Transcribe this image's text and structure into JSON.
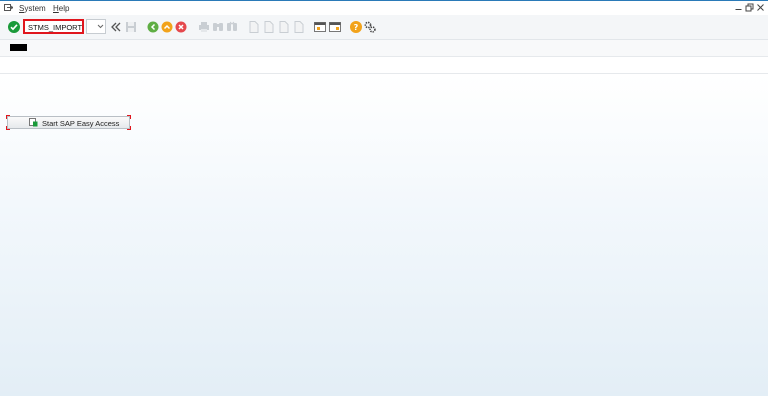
{
  "menubar": {
    "items": [
      {
        "label": "System",
        "mnemonic": "S"
      },
      {
        "label": "Help",
        "mnemonic": "H"
      }
    ],
    "icons": [
      "window-menu-icon",
      "minimize-icon",
      "restore-icon",
      "close-icon"
    ]
  },
  "toolbar": {
    "command_value": "STMS_IMPORT",
    "icons": [
      "enter-icon",
      "command-dropdown-icon",
      "collapse-field-icon",
      "save-icon",
      "back-icon",
      "exit-icon",
      "cancel-icon",
      "print-icon",
      "find-icon",
      "find-next-icon",
      "first-page-icon",
      "previous-page-icon",
      "next-page-icon",
      "last-page-icon",
      "create-session-icon",
      "generate-shortcut-icon",
      "help-icon",
      "customize-layout-icon"
    ],
    "colors": {
      "enter": "#1a9a3a",
      "back": "#5fae44",
      "exit": "#f2a31b",
      "cancel": "#e5484d",
      "help": "#f2a31b",
      "highlight": "#e0161d"
    }
  },
  "main": {
    "easy_access_label": "Start SAP Easy Access"
  }
}
